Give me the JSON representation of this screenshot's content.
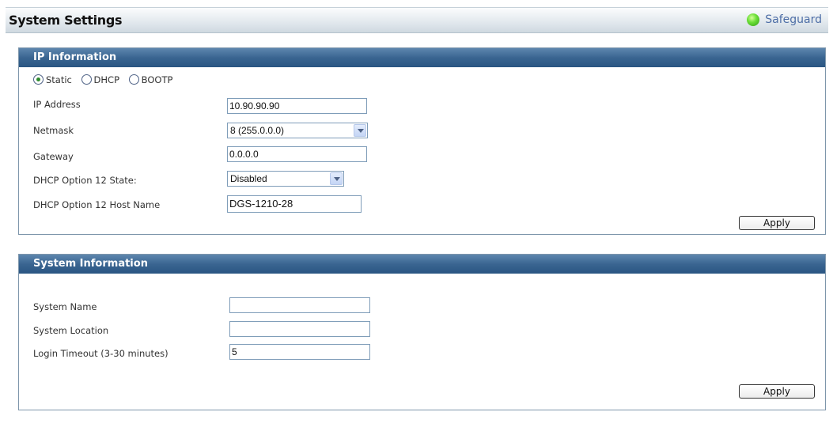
{
  "page": {
    "title": "System Settings",
    "safeguard_label": "Safeguard"
  },
  "ip_info": {
    "header": "IP Information",
    "mode_options": [
      "Static",
      "DHCP",
      "BOOTP"
    ],
    "selected_mode": "Static",
    "fields": {
      "ip_address": {
        "label": "IP Address",
        "value": "10.90.90.90"
      },
      "netmask": {
        "label": "Netmask",
        "value": "8 (255.0.0.0)"
      },
      "gateway": {
        "label": "Gateway",
        "value": "0.0.0.0"
      },
      "dhcp_opt12_state": {
        "label": "DHCP Option 12 State:",
        "value": "Disabled"
      },
      "dhcp_opt12_host": {
        "label": "DHCP Option 12 Host Name",
        "value": "DGS-1210-28"
      }
    },
    "apply_label": "Apply"
  },
  "system_info": {
    "header": "System Information",
    "fields": {
      "system_name": {
        "label": "System Name",
        "value": ""
      },
      "system_location": {
        "label": "System Location",
        "value": ""
      },
      "login_timeout": {
        "label": "Login Timeout (3-30 minutes)",
        "value": "5"
      }
    },
    "apply_label": "Apply"
  },
  "colors": {
    "panel_header": "#3a6591",
    "safeguard_led": "#6ee03a",
    "safeguard_text": "#4d6ea6"
  }
}
